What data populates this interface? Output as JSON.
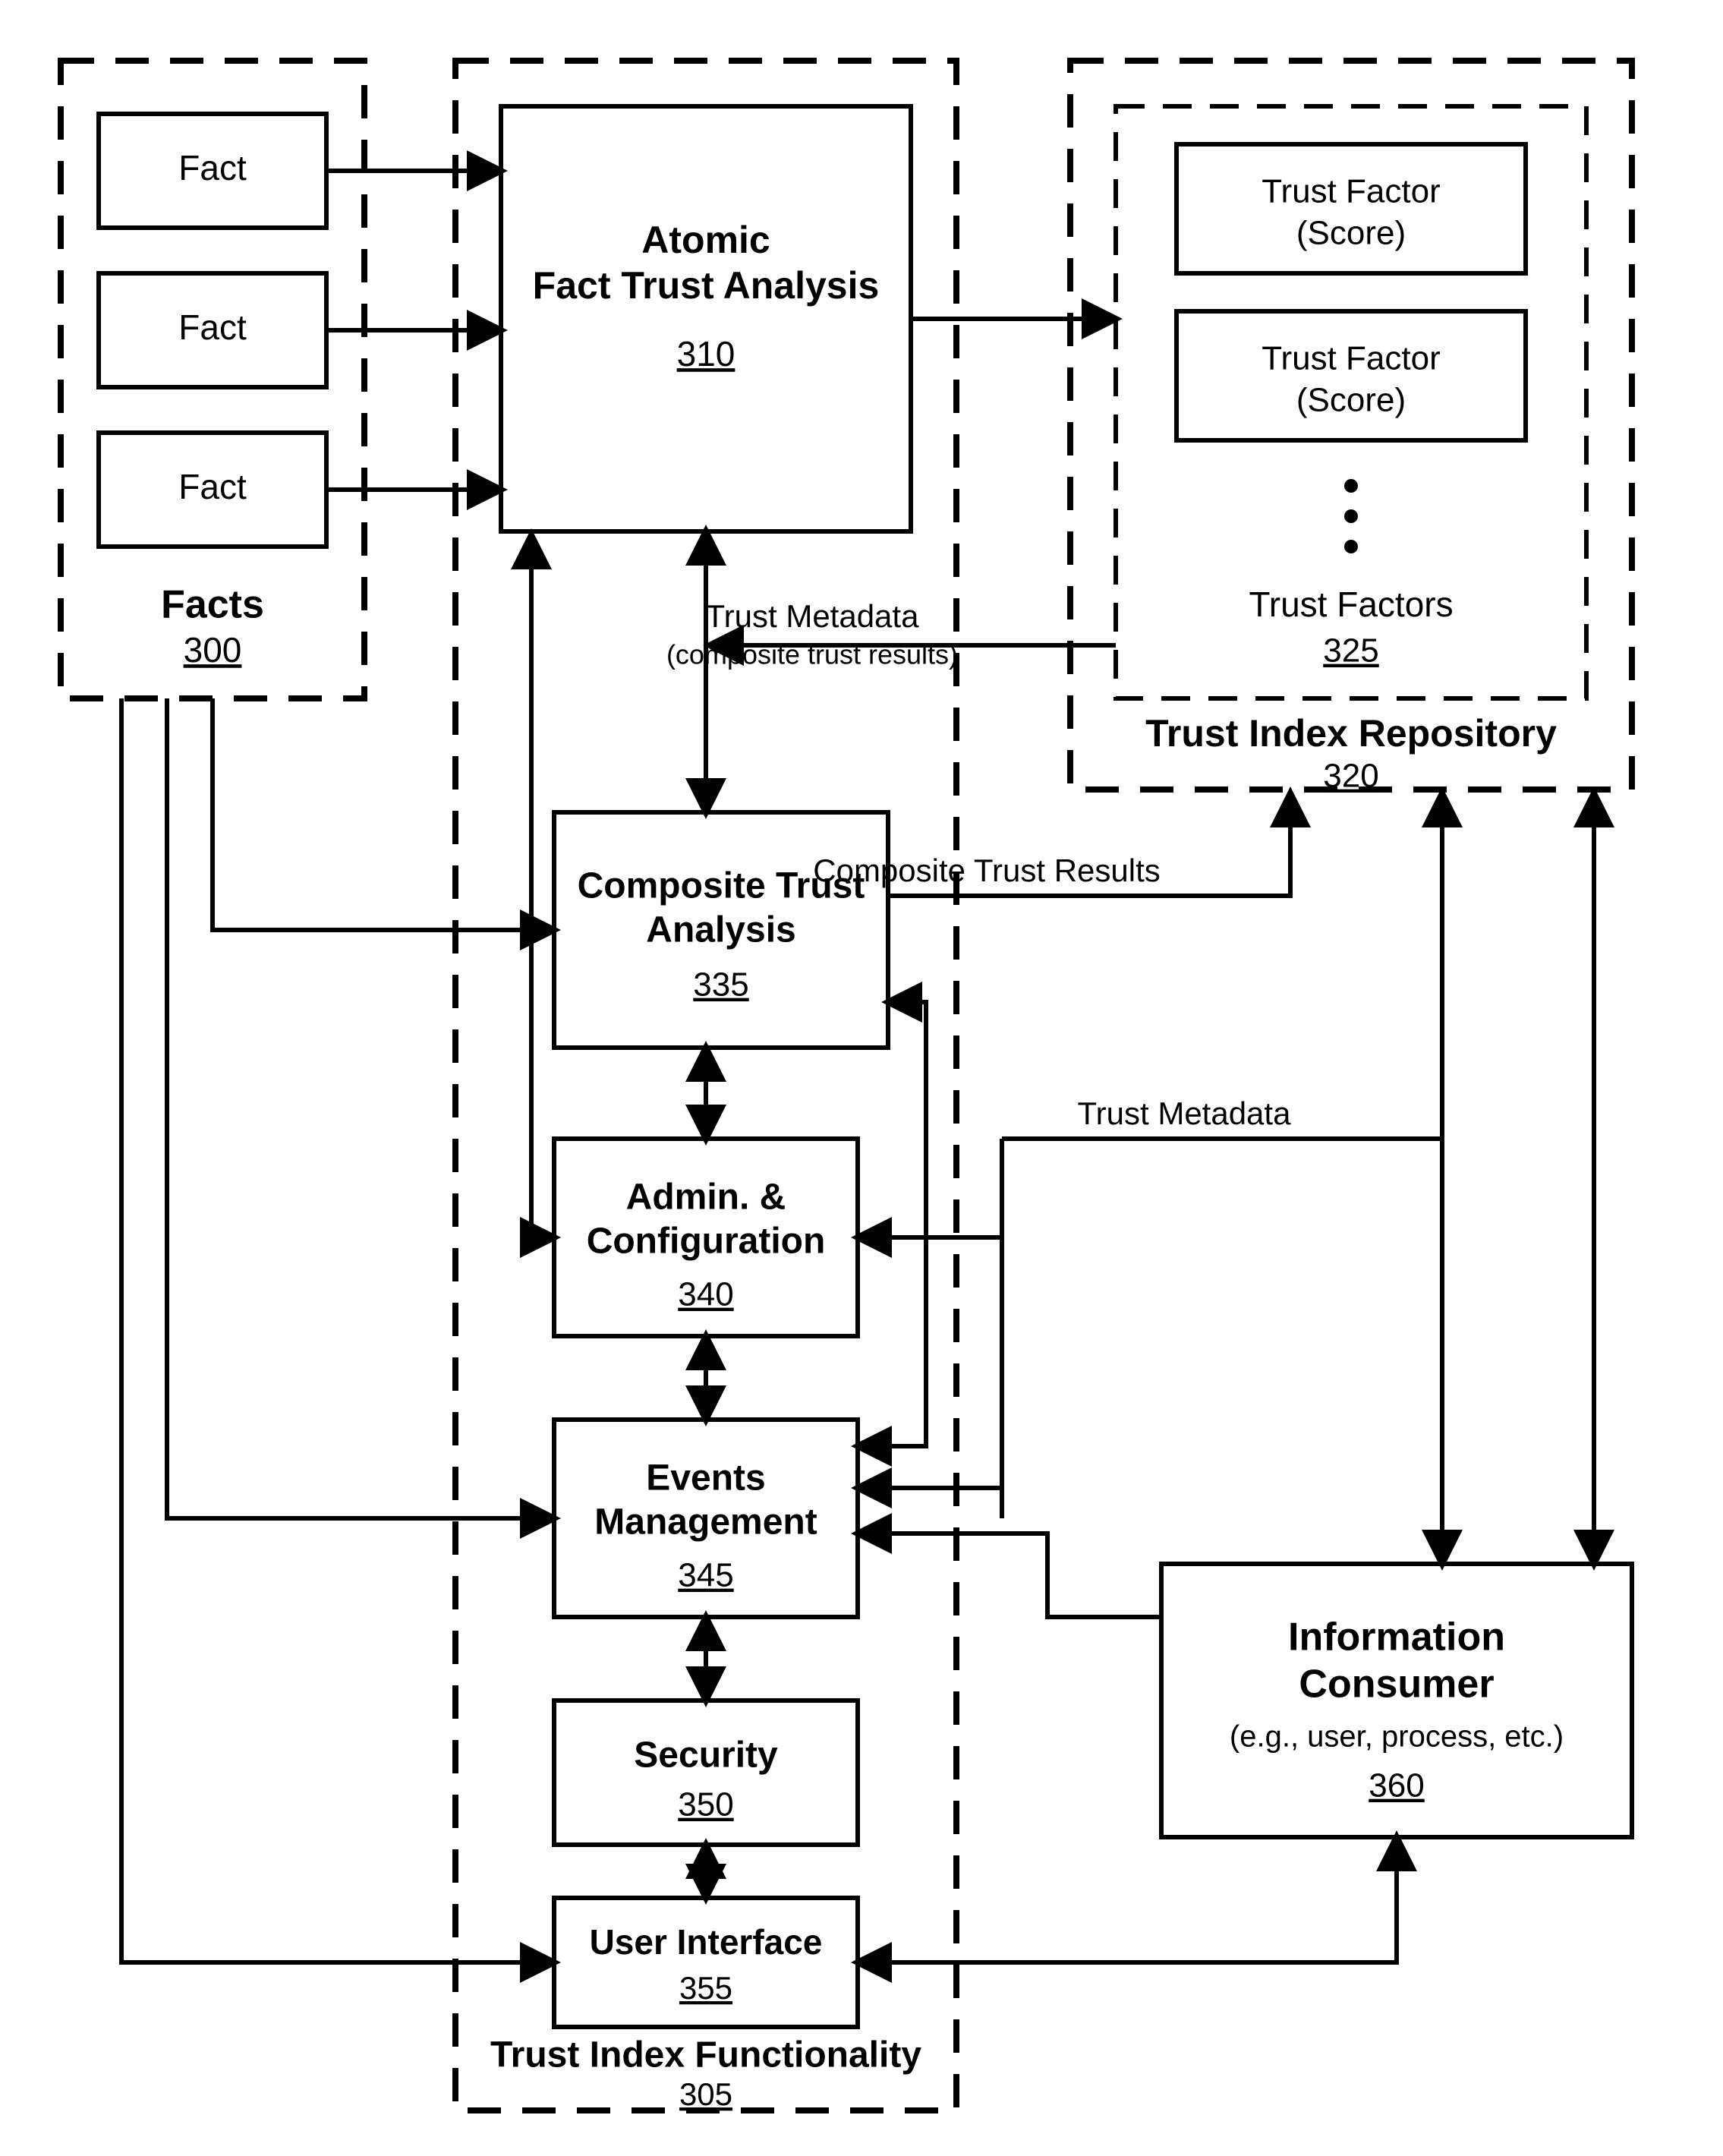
{
  "facts": {
    "group_label": "Facts",
    "group_ref": "300",
    "items": [
      "Fact",
      "Fact",
      "Fact"
    ]
  },
  "functionality": {
    "group_label": "Trust Index Functionality",
    "group_ref": "305",
    "atomic": {
      "l1": "Atomic",
      "l2": "Fact Trust Analysis",
      "ref": "310"
    },
    "composite": {
      "l1": "Composite Trust",
      "l2": "Analysis",
      "ref": "335"
    },
    "admin": {
      "l1": "Admin. &",
      "l2": "Configuration",
      "ref": "340"
    },
    "events": {
      "l1": "Events",
      "l2": "Management",
      "ref": "345"
    },
    "security": {
      "label": "Security",
      "ref": "350"
    },
    "ui": {
      "label": "User Interface",
      "ref": "355"
    }
  },
  "repository": {
    "group_label": "Trust Index Repository",
    "group_ref": "320",
    "factors_label": "Trust Factors",
    "factors_ref": "325",
    "factor_items": [
      {
        "l1": "Trust Factor",
        "l2": "(Score)"
      },
      {
        "l1": "Trust Factor",
        "l2": "(Score)"
      }
    ]
  },
  "consumer": {
    "l1": "Information",
    "l2": "Consumer",
    "sub": "(e.g., user, process, etc.)",
    "ref": "360"
  },
  "edge_labels": {
    "trust_metadata_1": "Trust Metadata",
    "composite_results_sub": "(composite trust results)",
    "composite_results": "Composite Trust Results",
    "trust_metadata_2": "Trust Metadata"
  }
}
